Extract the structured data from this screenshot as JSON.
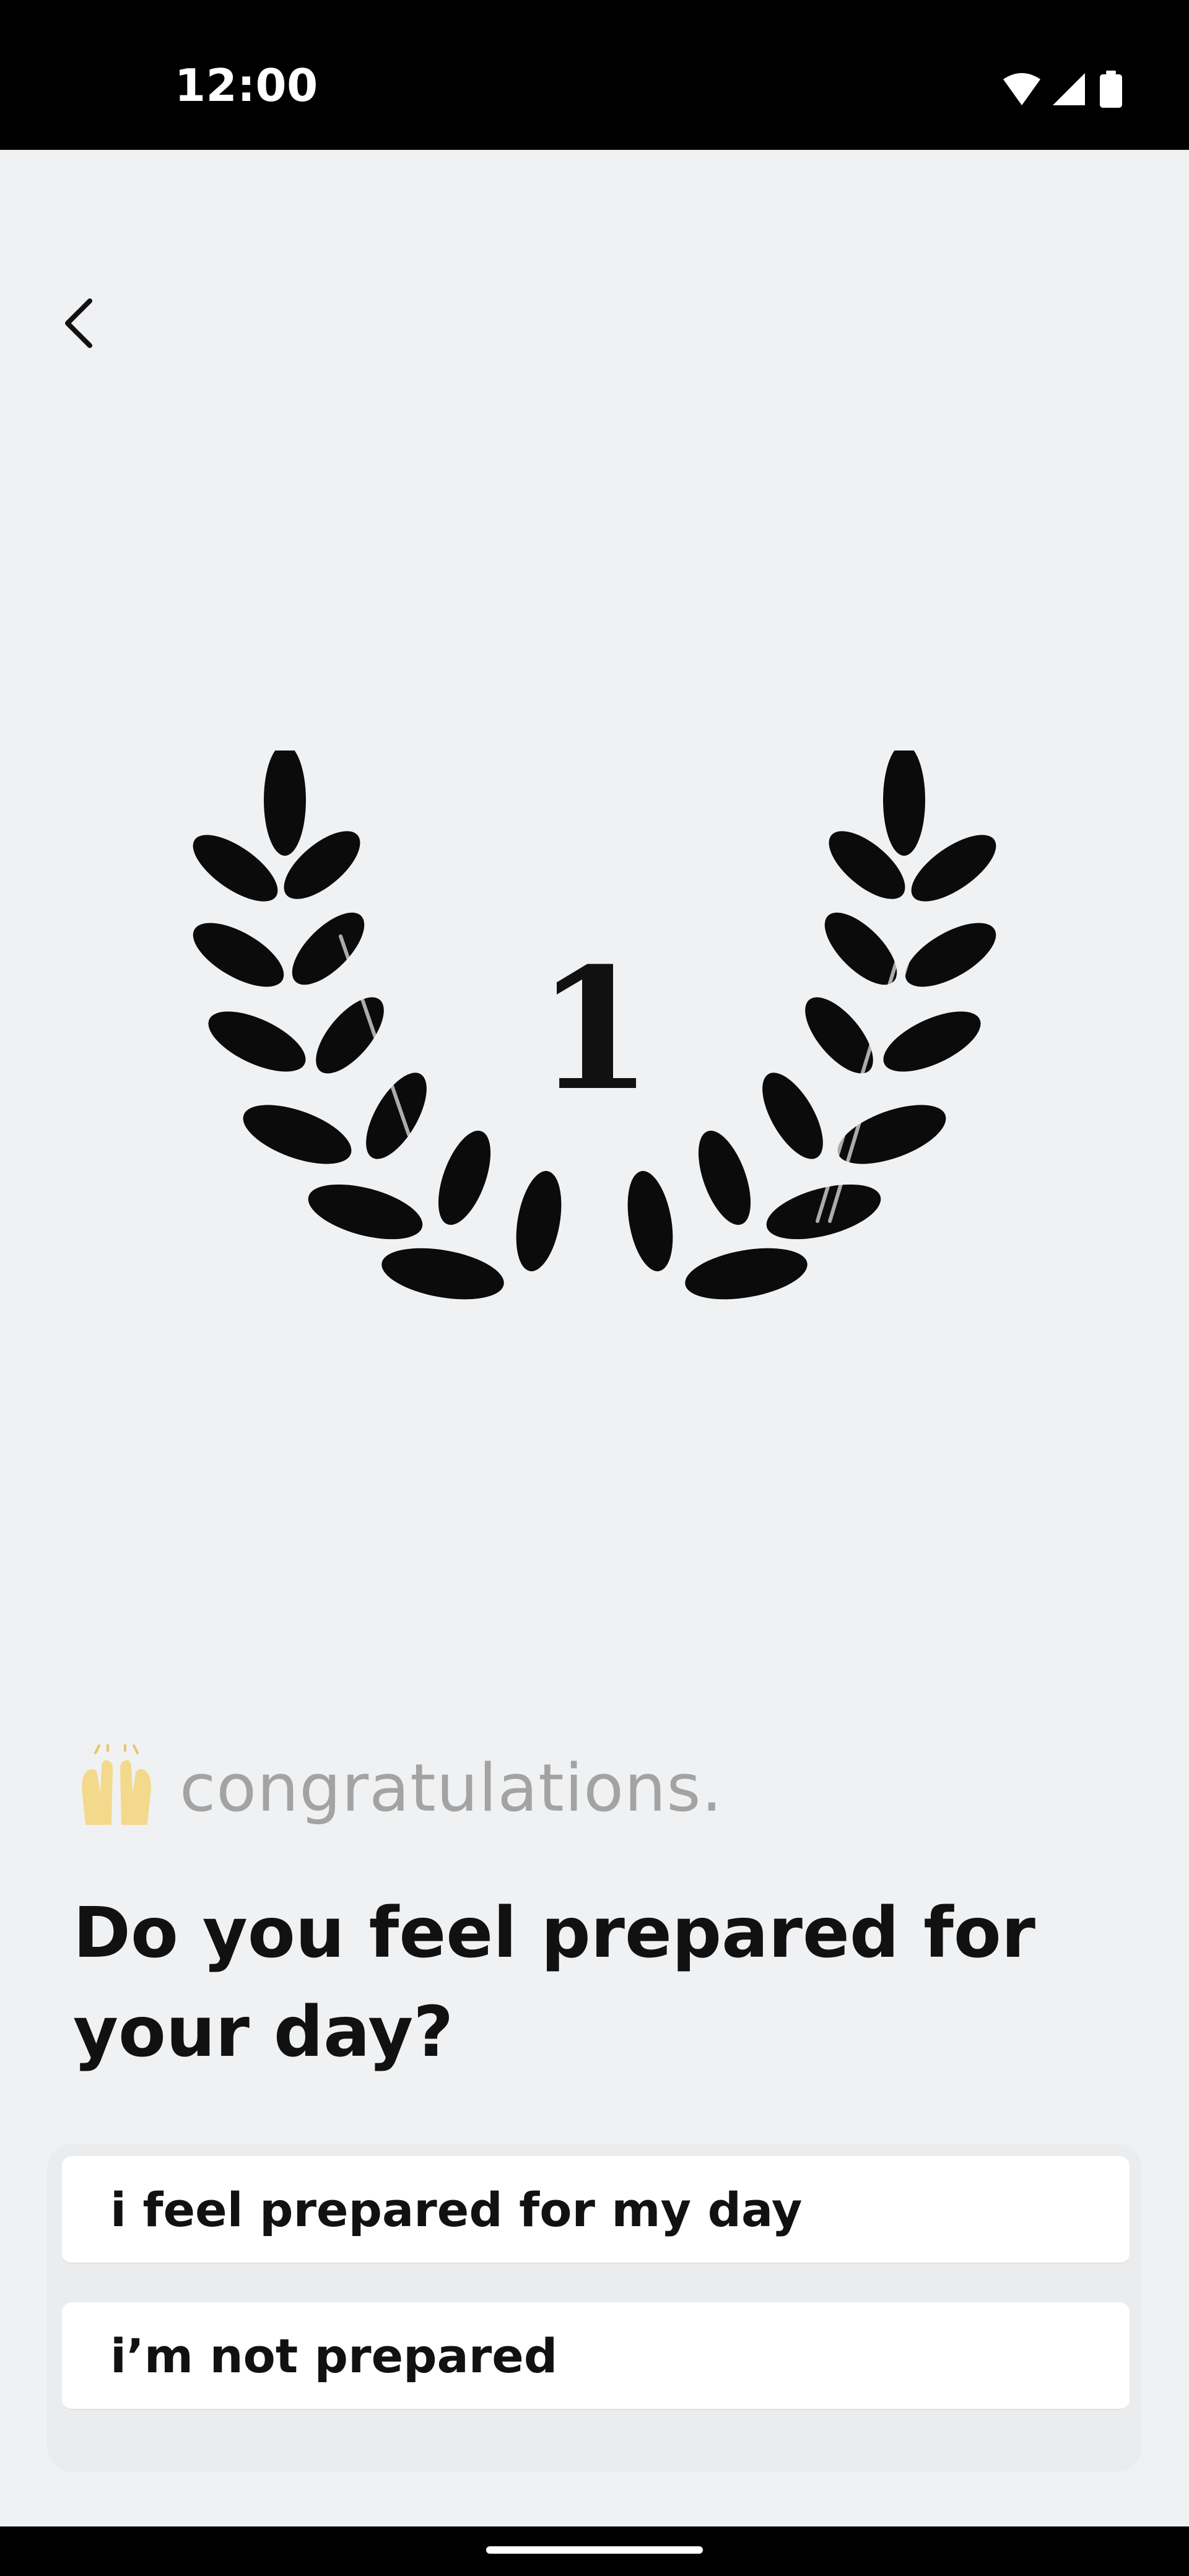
{
  "status_bar": {
    "time": "12:00",
    "icons": [
      "wifi-icon",
      "cellular-signal-icon",
      "battery-icon"
    ]
  },
  "header": {
    "back_icon": "chevron-left-icon"
  },
  "achievement": {
    "number": "1",
    "emblem": "laurel-wreath"
  },
  "congrats": {
    "emoji": "raising-hands-emoji",
    "text": "congratulations."
  },
  "question": {
    "text": "Do you feel prepared for your day?"
  },
  "options": [
    {
      "label": "i feel prepared for my day"
    },
    {
      "label": "i’m not prepared"
    }
  ],
  "colors": {
    "background": "#f0f1f3",
    "text": "#111111",
    "muted_text": "#a3a3a3",
    "option_background": "#ffffff"
  }
}
